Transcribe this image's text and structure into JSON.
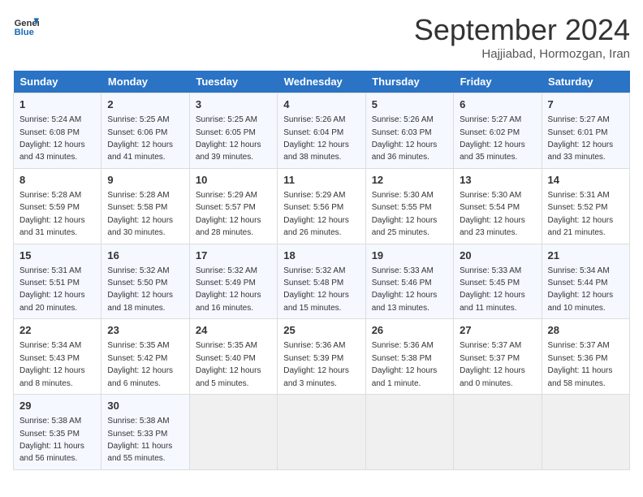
{
  "header": {
    "logo_line1": "General",
    "logo_line2": "Blue",
    "month_title": "September 2024",
    "subtitle": "Hajjiabad, Hormozgan, Iran"
  },
  "days_of_week": [
    "Sunday",
    "Monday",
    "Tuesday",
    "Wednesday",
    "Thursday",
    "Friday",
    "Saturday"
  ],
  "weeks": [
    [
      {
        "day": "1",
        "sunrise": "Sunrise: 5:24 AM",
        "sunset": "Sunset: 6:08 PM",
        "daylight": "Daylight: 12 hours and 43 minutes."
      },
      {
        "day": "2",
        "sunrise": "Sunrise: 5:25 AM",
        "sunset": "Sunset: 6:06 PM",
        "daylight": "Daylight: 12 hours and 41 minutes."
      },
      {
        "day": "3",
        "sunrise": "Sunrise: 5:25 AM",
        "sunset": "Sunset: 6:05 PM",
        "daylight": "Daylight: 12 hours and 39 minutes."
      },
      {
        "day": "4",
        "sunrise": "Sunrise: 5:26 AM",
        "sunset": "Sunset: 6:04 PM",
        "daylight": "Daylight: 12 hours and 38 minutes."
      },
      {
        "day": "5",
        "sunrise": "Sunrise: 5:26 AM",
        "sunset": "Sunset: 6:03 PM",
        "daylight": "Daylight: 12 hours and 36 minutes."
      },
      {
        "day": "6",
        "sunrise": "Sunrise: 5:27 AM",
        "sunset": "Sunset: 6:02 PM",
        "daylight": "Daylight: 12 hours and 35 minutes."
      },
      {
        "day": "7",
        "sunrise": "Sunrise: 5:27 AM",
        "sunset": "Sunset: 6:01 PM",
        "daylight": "Daylight: 12 hours and 33 minutes."
      }
    ],
    [
      {
        "day": "8",
        "sunrise": "Sunrise: 5:28 AM",
        "sunset": "Sunset: 5:59 PM",
        "daylight": "Daylight: 12 hours and 31 minutes."
      },
      {
        "day": "9",
        "sunrise": "Sunrise: 5:28 AM",
        "sunset": "Sunset: 5:58 PM",
        "daylight": "Daylight: 12 hours and 30 minutes."
      },
      {
        "day": "10",
        "sunrise": "Sunrise: 5:29 AM",
        "sunset": "Sunset: 5:57 PM",
        "daylight": "Daylight: 12 hours and 28 minutes."
      },
      {
        "day": "11",
        "sunrise": "Sunrise: 5:29 AM",
        "sunset": "Sunset: 5:56 PM",
        "daylight": "Daylight: 12 hours and 26 minutes."
      },
      {
        "day": "12",
        "sunrise": "Sunrise: 5:30 AM",
        "sunset": "Sunset: 5:55 PM",
        "daylight": "Daylight: 12 hours and 25 minutes."
      },
      {
        "day": "13",
        "sunrise": "Sunrise: 5:30 AM",
        "sunset": "Sunset: 5:54 PM",
        "daylight": "Daylight: 12 hours and 23 minutes."
      },
      {
        "day": "14",
        "sunrise": "Sunrise: 5:31 AM",
        "sunset": "Sunset: 5:52 PM",
        "daylight": "Daylight: 12 hours and 21 minutes."
      }
    ],
    [
      {
        "day": "15",
        "sunrise": "Sunrise: 5:31 AM",
        "sunset": "Sunset: 5:51 PM",
        "daylight": "Daylight: 12 hours and 20 minutes."
      },
      {
        "day": "16",
        "sunrise": "Sunrise: 5:32 AM",
        "sunset": "Sunset: 5:50 PM",
        "daylight": "Daylight: 12 hours and 18 minutes."
      },
      {
        "day": "17",
        "sunrise": "Sunrise: 5:32 AM",
        "sunset": "Sunset: 5:49 PM",
        "daylight": "Daylight: 12 hours and 16 minutes."
      },
      {
        "day": "18",
        "sunrise": "Sunrise: 5:32 AM",
        "sunset": "Sunset: 5:48 PM",
        "daylight": "Daylight: 12 hours and 15 minutes."
      },
      {
        "day": "19",
        "sunrise": "Sunrise: 5:33 AM",
        "sunset": "Sunset: 5:46 PM",
        "daylight": "Daylight: 12 hours and 13 minutes."
      },
      {
        "day": "20",
        "sunrise": "Sunrise: 5:33 AM",
        "sunset": "Sunset: 5:45 PM",
        "daylight": "Daylight: 12 hours and 11 minutes."
      },
      {
        "day": "21",
        "sunrise": "Sunrise: 5:34 AM",
        "sunset": "Sunset: 5:44 PM",
        "daylight": "Daylight: 12 hours and 10 minutes."
      }
    ],
    [
      {
        "day": "22",
        "sunrise": "Sunrise: 5:34 AM",
        "sunset": "Sunset: 5:43 PM",
        "daylight": "Daylight: 12 hours and 8 minutes."
      },
      {
        "day": "23",
        "sunrise": "Sunrise: 5:35 AM",
        "sunset": "Sunset: 5:42 PM",
        "daylight": "Daylight: 12 hours and 6 minutes."
      },
      {
        "day": "24",
        "sunrise": "Sunrise: 5:35 AM",
        "sunset": "Sunset: 5:40 PM",
        "daylight": "Daylight: 12 hours and 5 minutes."
      },
      {
        "day": "25",
        "sunrise": "Sunrise: 5:36 AM",
        "sunset": "Sunset: 5:39 PM",
        "daylight": "Daylight: 12 hours and 3 minutes."
      },
      {
        "day": "26",
        "sunrise": "Sunrise: 5:36 AM",
        "sunset": "Sunset: 5:38 PM",
        "daylight": "Daylight: 12 hours and 1 minute."
      },
      {
        "day": "27",
        "sunrise": "Sunrise: 5:37 AM",
        "sunset": "Sunset: 5:37 PM",
        "daylight": "Daylight: 12 hours and 0 minutes."
      },
      {
        "day": "28",
        "sunrise": "Sunrise: 5:37 AM",
        "sunset": "Sunset: 5:36 PM",
        "daylight": "Daylight: 11 hours and 58 minutes."
      }
    ],
    [
      {
        "day": "29",
        "sunrise": "Sunrise: 5:38 AM",
        "sunset": "Sunset: 5:35 PM",
        "daylight": "Daylight: 11 hours and 56 minutes."
      },
      {
        "day": "30",
        "sunrise": "Sunrise: 5:38 AM",
        "sunset": "Sunset: 5:33 PM",
        "daylight": "Daylight: 11 hours and 55 minutes."
      },
      null,
      null,
      null,
      null,
      null
    ]
  ]
}
